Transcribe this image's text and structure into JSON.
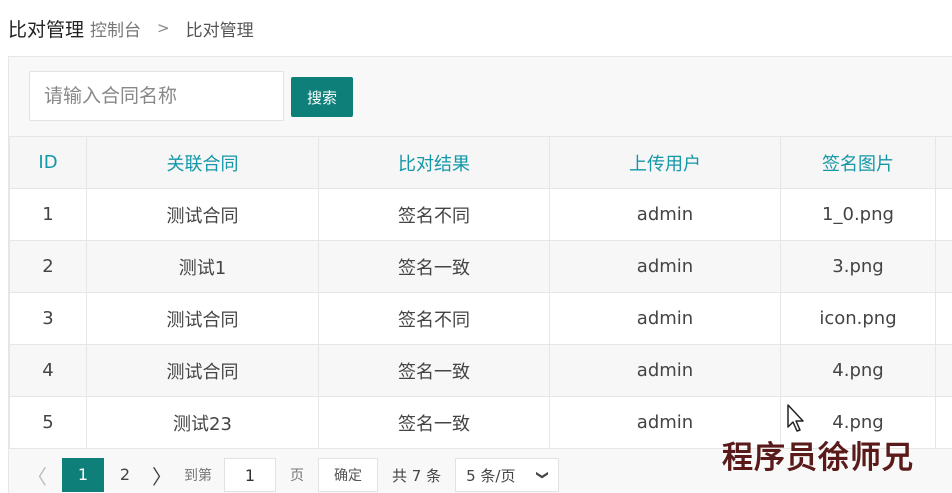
{
  "header": {
    "title": "比对管理",
    "breadcrumb_home": "控制台",
    "breadcrumb_sep": ">",
    "breadcrumb_current": "比对管理"
  },
  "search": {
    "placeholder": "请输入合同名称",
    "button_label": "搜索"
  },
  "table": {
    "columns": [
      "ID",
      "关联合同",
      "比对结果",
      "上传用户",
      "签名图片"
    ],
    "rows": [
      [
        "1",
        "测试合同",
        "签名不同",
        "admin",
        "1_0.png"
      ],
      [
        "2",
        "测试1",
        "签名一致",
        "admin",
        "3.png"
      ],
      [
        "3",
        "测试合同",
        "签名不同",
        "admin",
        "icon.png"
      ],
      [
        "4",
        "测试合同",
        "签名一致",
        "admin",
        "4.png"
      ],
      [
        "5",
        "测试23",
        "签名一致",
        "admin",
        "4.png"
      ]
    ]
  },
  "pagination": {
    "prev": "〈",
    "pages": [
      "1",
      "2"
    ],
    "next": "〉",
    "goto_label": "到第",
    "goto_value": "1",
    "page_label": "页",
    "confirm_label": "确定",
    "total_label": "共 7 条",
    "page_size": "5 条/页"
  },
  "watermark": "程序员徐师兄",
  "colors": {
    "accent": "#0f7f7a",
    "header_text": "#1497a8"
  }
}
